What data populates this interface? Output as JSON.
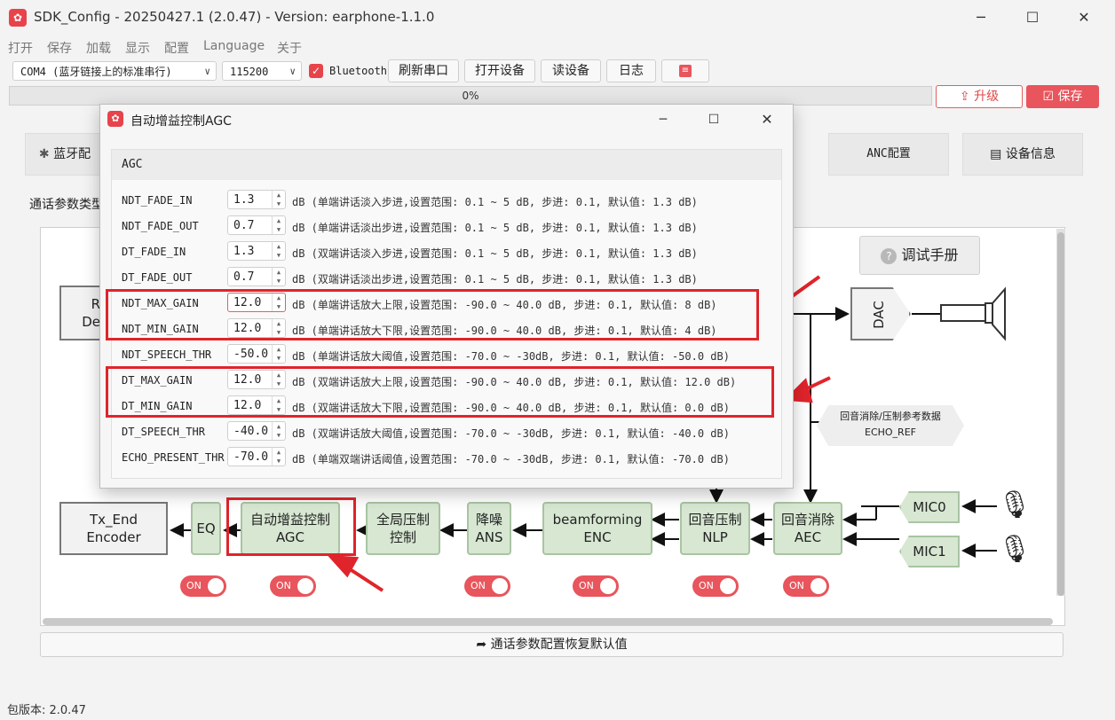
{
  "window": {
    "title": "SDK_Config -  20250427.1  (2.0.47) - Version: earphone-1.1.0",
    "logo": "✿"
  },
  "menu": [
    "打开",
    "保存",
    "加载",
    "显示",
    "配置",
    "Language",
    "关于"
  ],
  "toolbar": {
    "port": "COM4 (蓝牙链接上的标准串行)",
    "baud": "115200",
    "bluetooth_label": "Bluetooth",
    "bluetooth_checked": true,
    "refresh_port": "刷新串口",
    "open_device": "打开设备",
    "read_device": "读设备",
    "log": "日志",
    "log_icon": "≡"
  },
  "progress": {
    "value": 0,
    "label": "0%"
  },
  "actions": {
    "upgrade": "升级",
    "save": "保存"
  },
  "tabs": [
    "蓝牙配",
    "ANC配置",
    "设备信息"
  ],
  "section_label": "通话参数类型",
  "diagram": {
    "manual_button": "调试手册",
    "left_block": {
      "line1": "R",
      "line2": "De"
    },
    "dac": "DAC",
    "echo_ref": {
      "line1": "回音消除/压制参考数据",
      "line2": "ECHO_REF"
    },
    "tx_end": {
      "line1": "Tx_End",
      "line2": "Encoder"
    },
    "eq": "EQ",
    "agc": {
      "line1": "自动增益控制",
      "line2": "AGC"
    },
    "global_comp": {
      "line1": "全局压制",
      "line2": "控制"
    },
    "ans": {
      "line1": "降噪",
      "line2": "ANS"
    },
    "enc": {
      "line1": "beamforming",
      "line2": "ENC"
    },
    "nlp": {
      "line1": "回音压制",
      "line2": "NLP"
    },
    "aec": {
      "line1": "回音消除",
      "line2": "AEC"
    },
    "mic0": "MIC0",
    "mic1": "MIC1",
    "toggle_label": "ON"
  },
  "reset_button": "通话参数配置恢复默认值",
  "status": {
    "version": "包版本:  2.0.47"
  },
  "dialog": {
    "title": "自动增益控制AGC",
    "group": "AGC",
    "params": [
      {
        "name": "NDT_FADE_IN",
        "value": "1.3",
        "desc": "dB (单端讲话淡入步进,设置范围: 0.1 ~ 5 dB, 步进: 0.1, 默认值: 1.3 dB)"
      },
      {
        "name": "NDT_FADE_OUT",
        "value": "0.7",
        "desc": "dB (单端讲话淡出步进,设置范围: 0.1 ~ 5 dB, 步进: 0.1, 默认值: 1.3 dB)"
      },
      {
        "name": "DT_FADE_IN",
        "value": "1.3",
        "desc": "dB (双端讲话淡入步进,设置范围: 0.1 ~ 5 dB, 步进: 0.1, 默认值: 1.3 dB)"
      },
      {
        "name": "DT_FADE_OUT",
        "value": "0.7",
        "desc": "dB (双端讲话淡出步进,设置范围: 0.1 ~ 5 dB, 步进: 0.1, 默认值: 1.3 dB)"
      },
      {
        "name": "NDT_MAX_GAIN",
        "value": "12.0",
        "desc": "dB (单端讲话放大上限,设置范围: -90.0 ~ 40.0 dB, 步进: 0.1,  默认值: 8 dB)"
      },
      {
        "name": "NDT_MIN_GAIN",
        "value": "12.0",
        "desc": "dB (单端讲话放大下限,设置范围: -90.0 ~ 40.0 dB, 步进: 0.1,  默认值: 4 dB)"
      },
      {
        "name": "NDT_SPEECH_THR",
        "value": "-50.0",
        "desc": "dB (单端讲话放大阈值,设置范围: -70.0 ~ -30dB, 步进: 0.1, 默认值: -50.0 dB)"
      },
      {
        "name": "DT_MAX_GAIN",
        "value": "12.0",
        "desc": "dB (双端讲话放大上限,设置范围: -90.0 ~ 40.0 dB, 步进: 0.1,  默认值: 12.0 dB)"
      },
      {
        "name": "DT_MIN_GAIN",
        "value": "12.0",
        "desc": "dB (双端讲话放大下限,设置范围: -90.0 ~ 40.0 dB, 步进: 0.1,  默认值: 0.0 dB)"
      },
      {
        "name": "DT_SPEECH_THR",
        "value": "-40.0",
        "desc": "dB (双端讲话放大阈值,设置范围: -70.0 ~ -30dB, 步进: 0.1, 默认值: -40.0 dB)"
      },
      {
        "name": "ECHO_PRESENT_THR",
        "value": "-70.0",
        "desc": "dB (单端双端讲话阈值,设置范围: -70.0 ~ -30dB, 步进: 0.1, 默认值: -70.0 dB)"
      }
    ]
  },
  "colors": {
    "accent": "#e8434b",
    "block_fill": "#d7e7d2",
    "highlight": "#e0242b"
  }
}
